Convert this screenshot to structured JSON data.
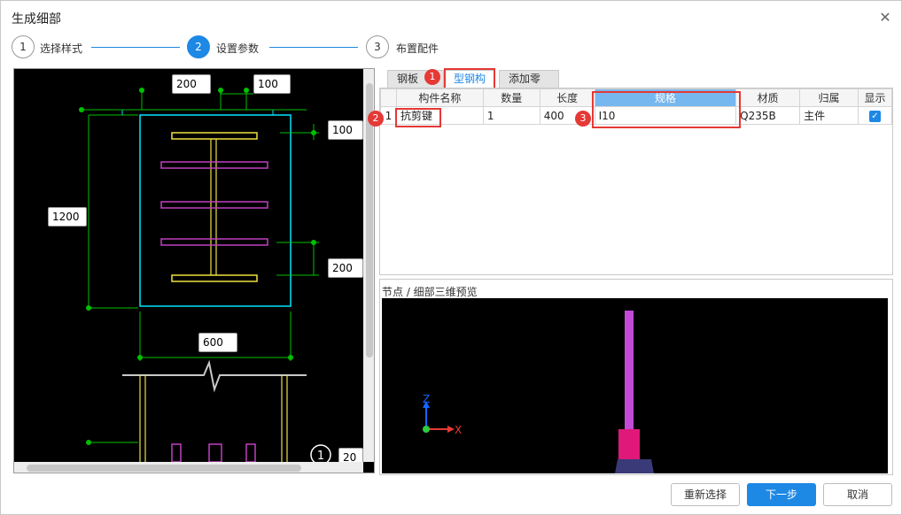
{
  "window": {
    "title": "生成细部"
  },
  "steps": [
    {
      "num": "1",
      "label": "选择样式",
      "state": "done"
    },
    {
      "num": "2",
      "label": "设置参数",
      "state": "active"
    },
    {
      "num": "3",
      "label": "布置配件",
      "state": "todo"
    }
  ],
  "drawing": {
    "dims": [
      "200",
      "100",
      "100",
      "1200",
      "200",
      "600",
      "20"
    ],
    "node_marker": "1"
  },
  "tabs": [
    {
      "label": "钢板"
    },
    {
      "label": "型钢构件"
    },
    {
      "label": "添加零件"
    }
  ],
  "callouts": [
    "1",
    "2",
    "3"
  ],
  "table": {
    "headers": [
      "",
      "构件名称",
      "数量",
      "长度",
      "规格",
      "材质",
      "归属",
      "显示"
    ],
    "rows": [
      {
        "index": "1",
        "name": "抗剪键",
        "qty": "1",
        "length": "400",
        "spec": "I10",
        "material": "Q235B",
        "owner": "主件",
        "visible": "✓"
      }
    ]
  },
  "preview": {
    "label": "节点 / 细部三维预览",
    "axis_z": "Z",
    "axis_x": "X"
  },
  "buttons": {
    "reselect": "重新选择",
    "next": "下一步",
    "cancel": "取消"
  },
  "colors": {
    "accent": "#1e88e5",
    "callout": "#e53935",
    "cad_cyan": "#00e5ff",
    "cad_yellow": "#f0e040",
    "cad_magenta": "#c040c0",
    "cad_green": "#00c000"
  }
}
